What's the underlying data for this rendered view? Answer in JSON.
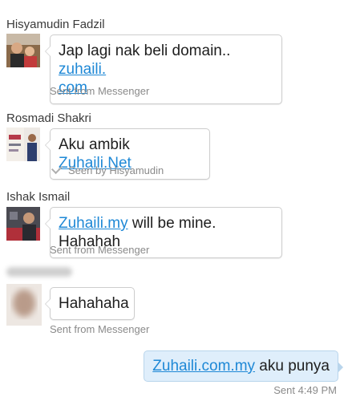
{
  "messages": [
    {
      "sender": "Hisyamudin Fadzil",
      "text": "Jap lagi nak beli domain.. ",
      "link": "zuhaili.",
      "link2": "com",
      "meta": "Sent from Messenger"
    },
    {
      "sender": "Rosmadi Shakri",
      "text": "Aku ambik ",
      "link": "Zuhaili.Net",
      "meta": "Seen by Hisyamudin"
    },
    {
      "sender": "Ishak Ismail",
      "link": "Zuhaili.my",
      "text": " will be mine. Hahahah",
      "meta": "Sent from Messenger"
    },
    {
      "text": "Hahahaha",
      "meta": "Sent from Messenger"
    }
  ],
  "own_message": {
    "link": "Zuhaili.com.my",
    "text": " aku punya",
    "meta": "Sent 4:49 PM"
  },
  "colors": {
    "link": "#1e88d6",
    "own_bubble": "#dfeefb"
  }
}
